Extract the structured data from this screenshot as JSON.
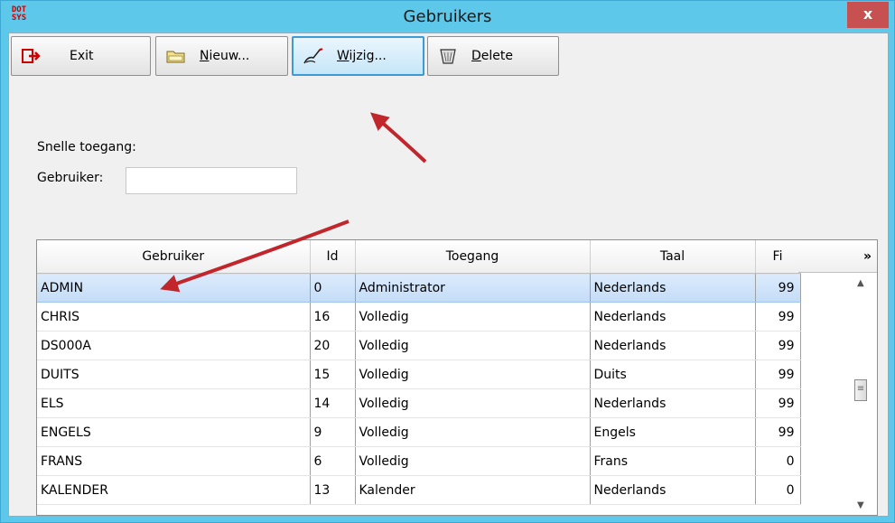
{
  "window": {
    "title": "Gebruikers",
    "icon_text_top": "DOT",
    "icon_text_bottom": "SYS",
    "close_glyph": "x"
  },
  "toolbar": {
    "exit": {
      "label": "Exit",
      "icon": "exit-arrow-icon"
    },
    "new": {
      "label_u": "N",
      "label_rest": "ieuw...",
      "icon": "folder-icon"
    },
    "edit": {
      "label_u": "W",
      "label_rest": "ijzig...",
      "icon": "pencil-hand-icon"
    },
    "delete": {
      "label_u": "D",
      "label_rest": "elete",
      "icon": "trash-icon"
    }
  },
  "quick_access": {
    "label": "Snelle toegang:",
    "user_label": "Gebruiker:",
    "user_value": ""
  },
  "grid": {
    "columns": [
      "Gebruiker",
      "Id",
      "Toegang",
      "Taal",
      "Fi"
    ],
    "more_glyph": "»",
    "rows": [
      [
        "ADMIN",
        "0",
        "Administrator",
        "Nederlands",
        "99"
      ],
      [
        "CHRIS",
        "16",
        "Volledig",
        "Nederlands",
        "99"
      ],
      [
        "DS000A",
        "20",
        "Volledig",
        "Nederlands",
        "99"
      ],
      [
        "DUITS",
        "15",
        "Volledig",
        "Duits",
        "99"
      ],
      [
        "ELS",
        "14",
        "Volledig",
        "Nederlands",
        "99"
      ],
      [
        "ENGELS",
        "9",
        "Volledig",
        "Engels",
        "99"
      ],
      [
        "FRANS",
        "6",
        "Volledig",
        "Frans",
        "0"
      ],
      [
        "KALENDER",
        "13",
        "Kalender",
        "Nederlands",
        "0"
      ]
    ],
    "selected_row": 0
  },
  "colors": {
    "titlebar": "#5ec8ea",
    "close": "#c75050",
    "selection": "#c3dcf6",
    "annotation_arrow": "#c0262c"
  }
}
